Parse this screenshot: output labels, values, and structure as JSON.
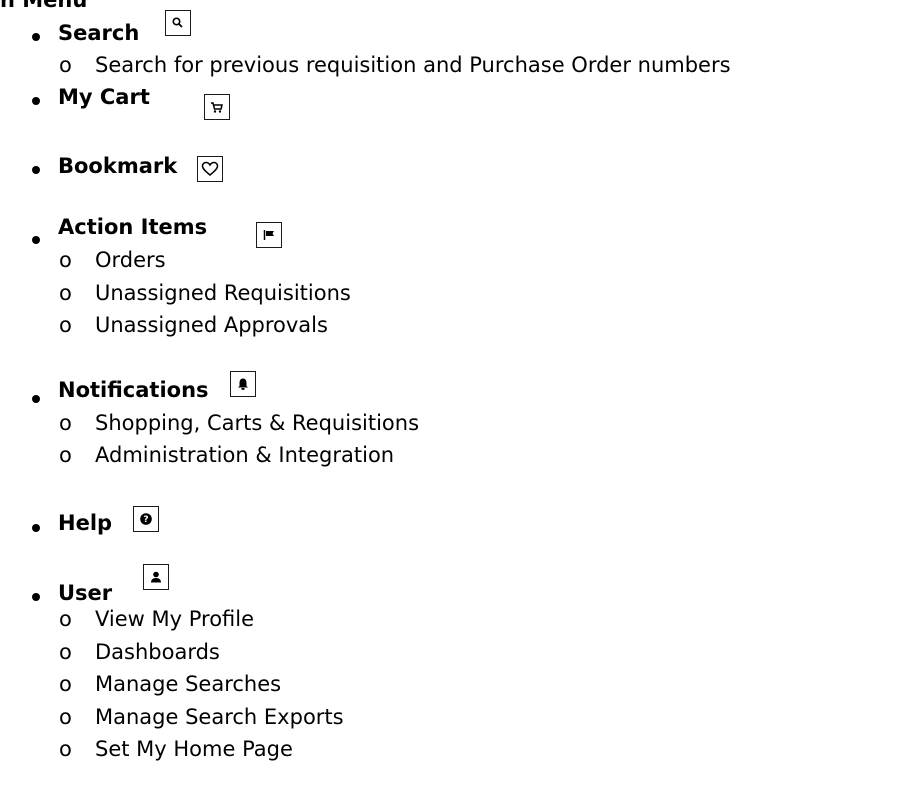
{
  "title": "n Menu",
  "items": [
    {
      "label": "Search",
      "icon": "search-icon",
      "subitems": [
        "Search for previous requisition and Purchase Order numbers"
      ]
    },
    {
      "label": "My Cart",
      "icon": "cart-icon",
      "subitems": []
    },
    {
      "label": "Bookmark",
      "icon": "heart-icon",
      "subitems": []
    },
    {
      "label": "Action Items",
      "icon": "flag-icon",
      "subitems": [
        "Orders",
        "Unassigned Requisitions",
        "Unassigned Approvals"
      ]
    },
    {
      "label": "Notifications",
      "icon": "bell-icon",
      "subitems": [
        "Shopping, Carts & Requisitions",
        "Administration & Integration"
      ]
    },
    {
      "label": "Help",
      "icon": "help-icon",
      "subitems": []
    },
    {
      "label": "User",
      "icon": "user-icon",
      "subitems": [
        "View My Profile",
        "Dashboards",
        "Manage Searches",
        "Manage Search Exports",
        "Set My Home Page"
      ]
    }
  ],
  "sub_marker": "o"
}
